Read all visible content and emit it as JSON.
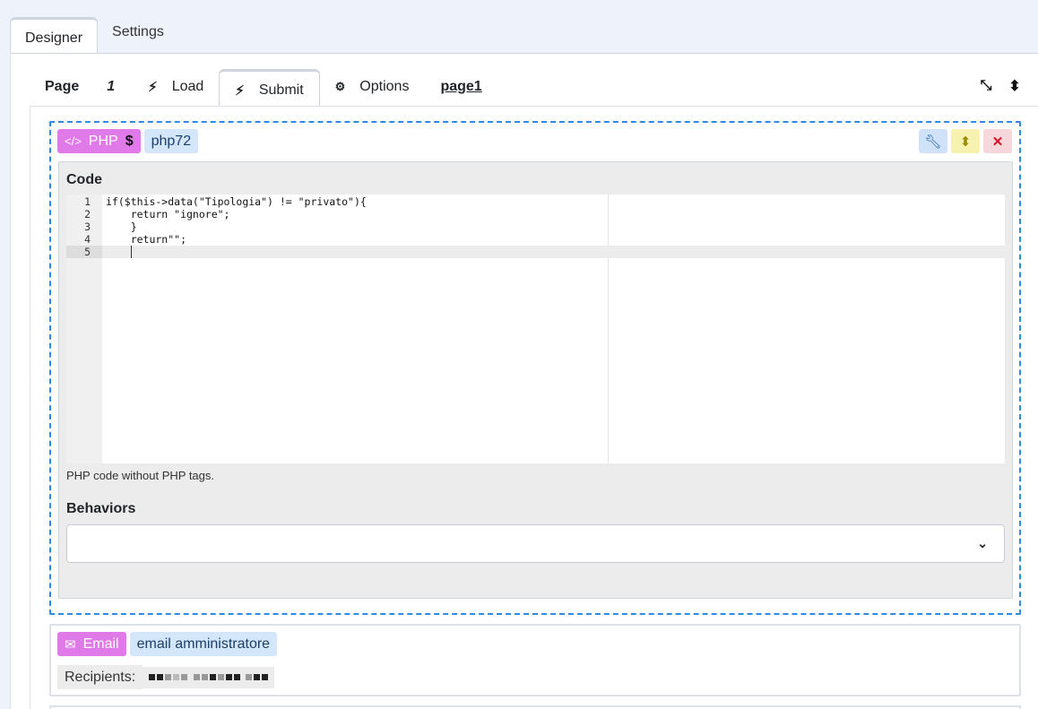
{
  "top_tabs": {
    "designer": "Designer",
    "settings": "Settings"
  },
  "subtabs": {
    "page_label": "Page",
    "page_number": "1",
    "load": "Load",
    "submit": "Submit",
    "options": "Options",
    "page_link": "page1"
  },
  "php_block": {
    "type": "PHP",
    "name": "php72",
    "code_title": "Code",
    "lines": [
      {
        "num": "1",
        "text": "if($this->data(\"Tipologia\") != \"privato\"){"
      },
      {
        "num": "2",
        "text": "    return \"ignore\";"
      },
      {
        "num": "3",
        "text": "    }"
      },
      {
        "num": "4",
        "text": "    return\"\";"
      },
      {
        "num": "5",
        "text": ""
      }
    ],
    "help_text": "PHP code without PHP tags.",
    "behaviors_title": "Behaviors"
  },
  "email_block": {
    "type": "Email",
    "name": "email amministratore",
    "recipients_label": "Recipients:"
  },
  "colors": {
    "accent_blue": "#2c8ae8",
    "type_chip": "#e07ae9",
    "name_chip": "#d4e6f9",
    "delete": "#d2142b"
  },
  "icons": [
    "bolt-icon",
    "gears-icon",
    "compress-icon",
    "sort-icon",
    "close-icon",
    "code-icon",
    "dollar-icon",
    "wrench-icon",
    "envelope-icon",
    "chevron-down-icon"
  ]
}
